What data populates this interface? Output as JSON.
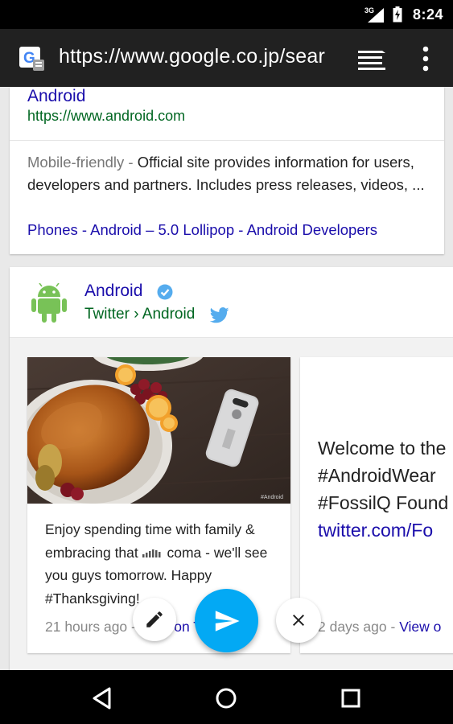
{
  "status_bar": {
    "time": "8:24",
    "network": "3G"
  },
  "toolbar": {
    "url": "https://www.google.co.jp/sear"
  },
  "result": {
    "title": "Android",
    "url": "https://www.android.com",
    "snippet_tag": "Mobile-friendly",
    "snippet_sep": " - ",
    "snippet": "Official site provides information for users, developers and partners. Includes press releases, videos, ...",
    "sitelinks": [
      {
        "label": "Phones"
      },
      {
        "label": "Android – 5.0 Lollipop"
      },
      {
        "label": "Android Developers"
      }
    ],
    "sitelink_sep": " - "
  },
  "twitter_card": {
    "name": "Android",
    "path": "Twitter › Android",
    "tweets": [
      {
        "text_before": "Enjoy spending time with family & embracing that ",
        "text_after": " coma - we'll see you guys tomorrow. Happy #Thanksgiving!",
        "time": "21 hours ago",
        "meta_sep": " - ",
        "view_link": "View on Twitter",
        "photo_watermark": "#Android"
      },
      {
        "line1": "Welcome to the",
        "line2": "#AndroidWear",
        "line3": "#FossilQ Found",
        "line4_link": "twitter.com/Fo",
        "time": "2 days ago",
        "meta_sep": " - ",
        "view_link": "View o"
      }
    ]
  },
  "colors": {
    "link": "#1a0dab",
    "url_green": "#006621",
    "fab_send": "#03a9f4",
    "android_green": "#78c257",
    "twitter_blue": "#55acee"
  },
  "icons": {
    "favicon": "google-favicon-icon",
    "tabs": "tabs-icon",
    "menu": "overflow-menu-icon",
    "edit": "pencil-icon",
    "send": "send-icon",
    "close": "close-icon",
    "back": "back-icon",
    "home": "home-icon",
    "recents": "recents-icon"
  }
}
